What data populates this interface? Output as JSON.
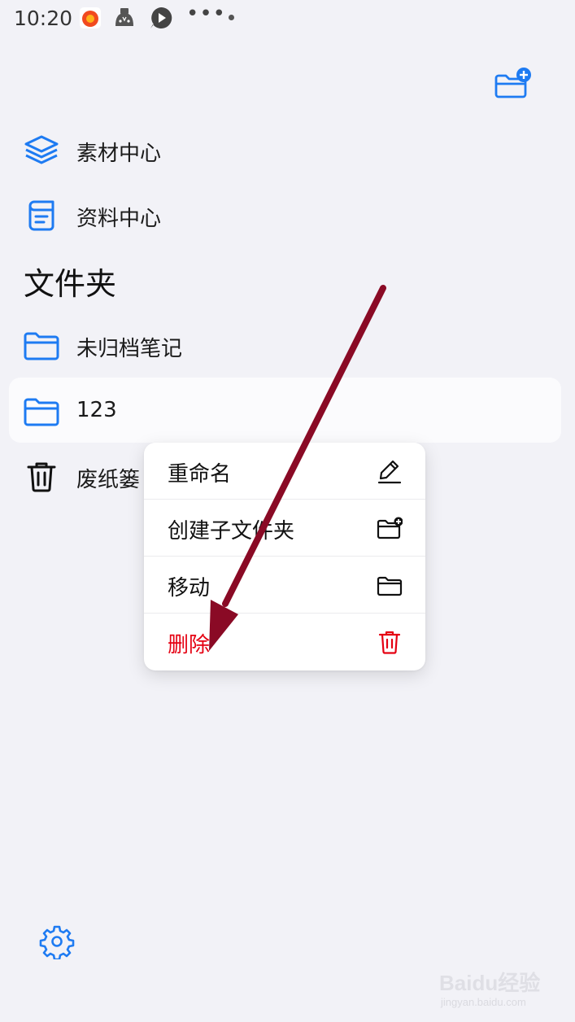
{
  "status_bar": {
    "time": "10:20",
    "icons": [
      "news-app-icon",
      "game-controller-icon",
      "play-app-icon",
      "more-icon",
      "notification-dot-icon"
    ],
    "more": "•••"
  },
  "toolbar": {
    "new_folder_icon": "folder-plus-icon"
  },
  "nav": {
    "items": [
      {
        "label": "素材中心",
        "icon": "layers-icon"
      },
      {
        "label": "资料中心",
        "icon": "document-icon"
      }
    ]
  },
  "folders": {
    "title": "文件夹",
    "items": [
      {
        "label": "未归档笔记",
        "icon": "folder-icon"
      },
      {
        "label": "123",
        "icon": "folder-icon",
        "selected": true
      },
      {
        "label": "废纸篓",
        "icon": "trash-icon"
      }
    ]
  },
  "context_menu": {
    "items": [
      {
        "label": "重命名",
        "icon": "pencil-icon"
      },
      {
        "label": "创建子文件夹",
        "icon": "folder-plus-icon"
      },
      {
        "label": "移动",
        "icon": "folder-icon"
      },
      {
        "label": "删除",
        "icon": "trash-icon",
        "danger": true
      }
    ]
  },
  "settings": {
    "icon": "gear-icon"
  },
  "watermark": {
    "text": "Baidu经验",
    "sub": "jingyan.baidu.com"
  },
  "colors": {
    "accent": "#1e7bf2",
    "danger": "#e50012",
    "annotation_arrow": "#8a0a25",
    "background": "#f2f2f7"
  }
}
